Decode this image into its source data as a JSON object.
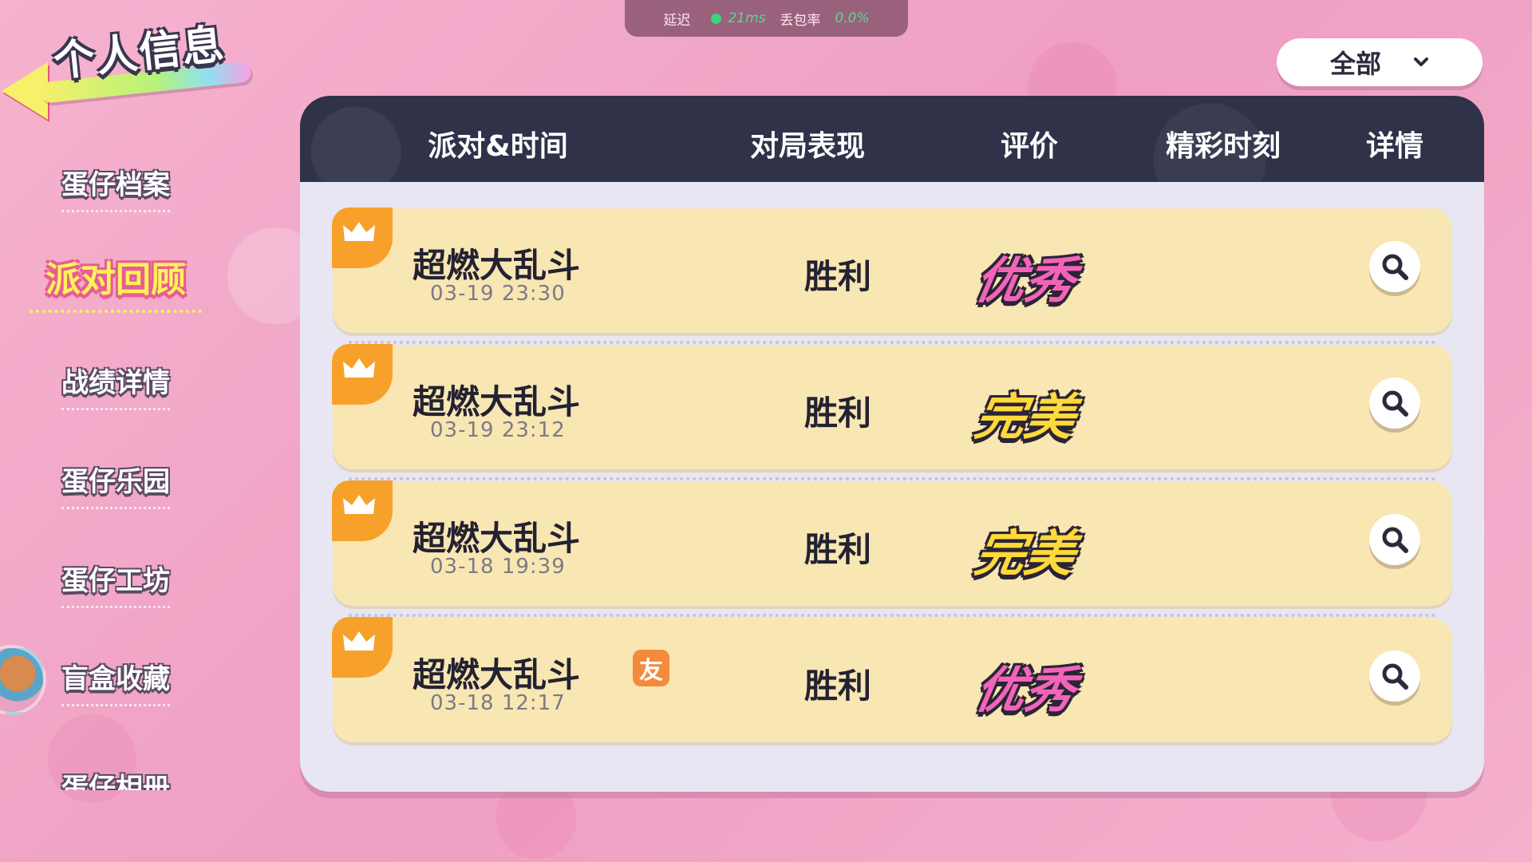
{
  "network": {
    "latency_label": "延迟",
    "latency_value": "21ms",
    "loss_label": "丢包率",
    "loss_value": "0.0%"
  },
  "header": {
    "title": "个人信息"
  },
  "sidebar": {
    "items": [
      {
        "label": "蛋仔档案"
      },
      {
        "label": "派对回顾",
        "active": true
      },
      {
        "label": "战绩详情"
      },
      {
        "label": "蛋仔乐园"
      },
      {
        "label": "蛋仔工坊"
      },
      {
        "label": "盲盒收藏"
      },
      {
        "label": "蛋仔相册"
      }
    ]
  },
  "filter": {
    "selected": "全部"
  },
  "table": {
    "columns": [
      "派对&时间",
      "对局表现",
      "评价",
      "精彩时刻",
      "详情"
    ],
    "rows": [
      {
        "mode": "超燃大乱斗",
        "time": "03-19 23:30",
        "result": "胜利",
        "grade": "优秀",
        "grade_color": "#f364b9",
        "friend": ""
      },
      {
        "mode": "超燃大乱斗",
        "time": "03-19 23:12",
        "result": "胜利",
        "grade": "完美",
        "grade_color": "#ffd93a",
        "friend": ""
      },
      {
        "mode": "超燃大乱斗",
        "time": "03-18 19:39",
        "result": "胜利",
        "grade": "完美",
        "grade_color": "#ffd93a",
        "friend": ""
      },
      {
        "mode": "超燃大乱斗",
        "time": "03-18 12:17",
        "result": "胜利",
        "grade": "优秀",
        "grade_color": "#f364b9",
        "friend": "友"
      }
    ]
  },
  "colors": {
    "background": "#f2a9c8",
    "header_bar": "#2f3249",
    "row_bg": "#f8e6b3",
    "crown_tab": "#f7a12a",
    "active_tab": "#fff25a"
  }
}
